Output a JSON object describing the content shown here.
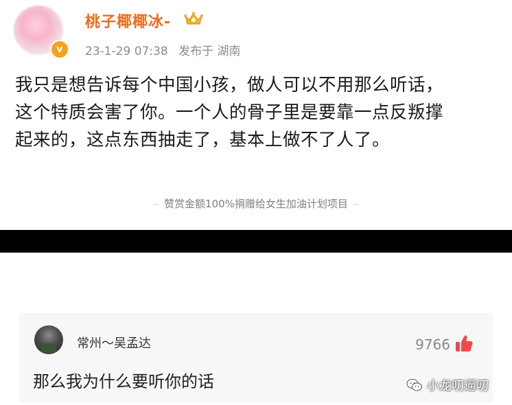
{
  "post": {
    "username": "桃子椰椰冰-",
    "verified_icon": "verified-badge-icon",
    "crown_icon": "crown-icon",
    "date": "23-1-29 07:38",
    "source": "发布于 湖南",
    "body_lines": [
      "我只是想告诉每个中国小孩，做人可以不用那么听话，",
      "这个特质会害了你。一个人的骨子里是要靠一点反叛撑",
      "起来的，这点东西抽走了，基本上做不了人了。"
    ],
    "reward_text": "赞赏金额100%捐赠给女生加油计划项目"
  },
  "comment": {
    "author": "常州～吴孟达",
    "likes": "9766",
    "text": "那么我为什么要听你的话"
  },
  "watermark": {
    "text": "小龙叨逼叨"
  },
  "colors": {
    "username": "#f26a1b",
    "badge": "#f7a21b",
    "divider": "#000000",
    "comment_bg": "#f7f7f7",
    "like_icon": "#f24a4a"
  }
}
